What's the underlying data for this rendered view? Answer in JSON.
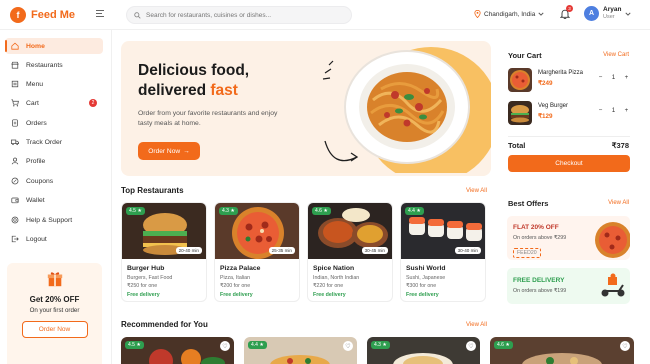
{
  "app": {
    "name": "Feed Me",
    "logo_letter": "f"
  },
  "search": {
    "placeholder": "Search for restaurants, cuisines or dishes..."
  },
  "location": {
    "label": "Chandigarh, India"
  },
  "notifications": {
    "count": "3"
  },
  "user": {
    "initial": "A",
    "name": "Aryan",
    "role": "User"
  },
  "sidebar": {
    "items": [
      {
        "label": "Home",
        "icon": "home-icon"
      },
      {
        "label": "Restaurants",
        "icon": "store-icon"
      },
      {
        "label": "Menu",
        "icon": "menu-book-icon"
      },
      {
        "label": "Cart",
        "icon": "cart-icon",
        "badge": "2"
      },
      {
        "label": "Orders",
        "icon": "orders-icon"
      },
      {
        "label": "Track Order",
        "icon": "truck-icon"
      },
      {
        "label": "Profile",
        "icon": "user-icon"
      },
      {
        "label": "Coupons",
        "icon": "coupon-icon"
      },
      {
        "label": "Wallet",
        "icon": "wallet-icon"
      },
      {
        "label": "Help & Support",
        "icon": "help-icon"
      },
      {
        "label": "Logout",
        "icon": "logout-icon"
      }
    ],
    "promo": {
      "title": "Get 20% OFF",
      "subtitle": "On your first order",
      "button": "Order Now"
    }
  },
  "hero": {
    "title_line1": "Delicious food,",
    "title_line2": "delivered ",
    "title_accent": "fast",
    "subtitle": "Order from your favorite restaurants and enjoy tasty meals at home.",
    "button": "Order Now"
  },
  "top_restaurants": {
    "title": "Top Restaurants",
    "view_all": "View All",
    "items": [
      {
        "name": "Burger Hub",
        "cuisine": "Burgers, Fast Food",
        "price": "₹250 for one",
        "delivery": "Free delivery",
        "rating": "4.5 ★",
        "time": "20-40 min"
      },
      {
        "name": "Pizza Palace",
        "cuisine": "Pizza, Italian",
        "price": "₹200 for one",
        "delivery": "Free delivery",
        "rating": "4.3 ★",
        "time": "25-35 min"
      },
      {
        "name": "Spice Nation",
        "cuisine": "Indian, North Indian",
        "price": "₹220 for one",
        "delivery": "Free delivery",
        "rating": "4.6 ★",
        "time": "30-45 min"
      },
      {
        "name": "Sushi World",
        "cuisine": "Sushi, Japanese",
        "price": "₹300 for one",
        "delivery": "Free delivery",
        "rating": "4.4 ★",
        "time": "30-40 min"
      }
    ]
  },
  "recommended": {
    "title": "Recommended for You",
    "view_all": "View All",
    "items": [
      {
        "rating": "4.5 ★"
      },
      {
        "rating": "4.4 ★"
      },
      {
        "rating": "4.3 ★"
      },
      {
        "rating": "4.6 ★"
      }
    ]
  },
  "cart": {
    "title": "Your Cart",
    "view": "View Cart",
    "items": [
      {
        "name": "Margherita Pizza",
        "price": "₹249",
        "qty": "1"
      },
      {
        "name": "Veg Burger",
        "price": "₹129",
        "qty": "1"
      }
    ],
    "total_label": "Total",
    "total_value": "₹378",
    "checkout": "Checkout"
  },
  "offers": {
    "title": "Best Offers",
    "view_all": "View All",
    "items": [
      {
        "title": "FLAT 20% OFF",
        "subtitle": "On orders above ₹299",
        "code": "FEED20"
      },
      {
        "title": "FREE DELIVERY",
        "subtitle": "On orders above ₹199"
      }
    ]
  },
  "colors": {
    "accent": "#f26a1b",
    "success": "#2e9e4f",
    "badge": "#e53935"
  }
}
